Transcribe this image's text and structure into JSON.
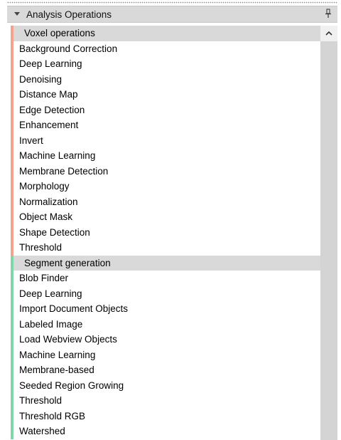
{
  "panel": {
    "title": "Analysis Operations",
    "collapse_icon": "triangle-down-icon",
    "pin_icon": "pin-icon"
  },
  "groups": [
    {
      "label": "Voxel operations",
      "color": "#f4a28c",
      "items": [
        "Background Correction",
        "Deep Learning",
        "Denoising",
        "Distance Map",
        "Edge Detection",
        "Enhancement",
        "Invert",
        "Machine Learning",
        "Membrane Detection",
        "Morphology",
        "Normalization",
        "Object Mask",
        "Shape Detection",
        "Threshold"
      ]
    },
    {
      "label": "Segment generation",
      "color": "#7fd6a8",
      "items": [
        "Blob Finder",
        "Deep Learning",
        "Import Document Objects",
        "Labeled Image",
        "Load Webview Objects",
        "Machine Learning",
        "Membrane-based",
        "Seeded Region Growing",
        "Threshold",
        "Threshold RGB",
        "Watershed"
      ]
    }
  ],
  "scrollbar": {
    "up_icon": "chevron-up-icon"
  }
}
